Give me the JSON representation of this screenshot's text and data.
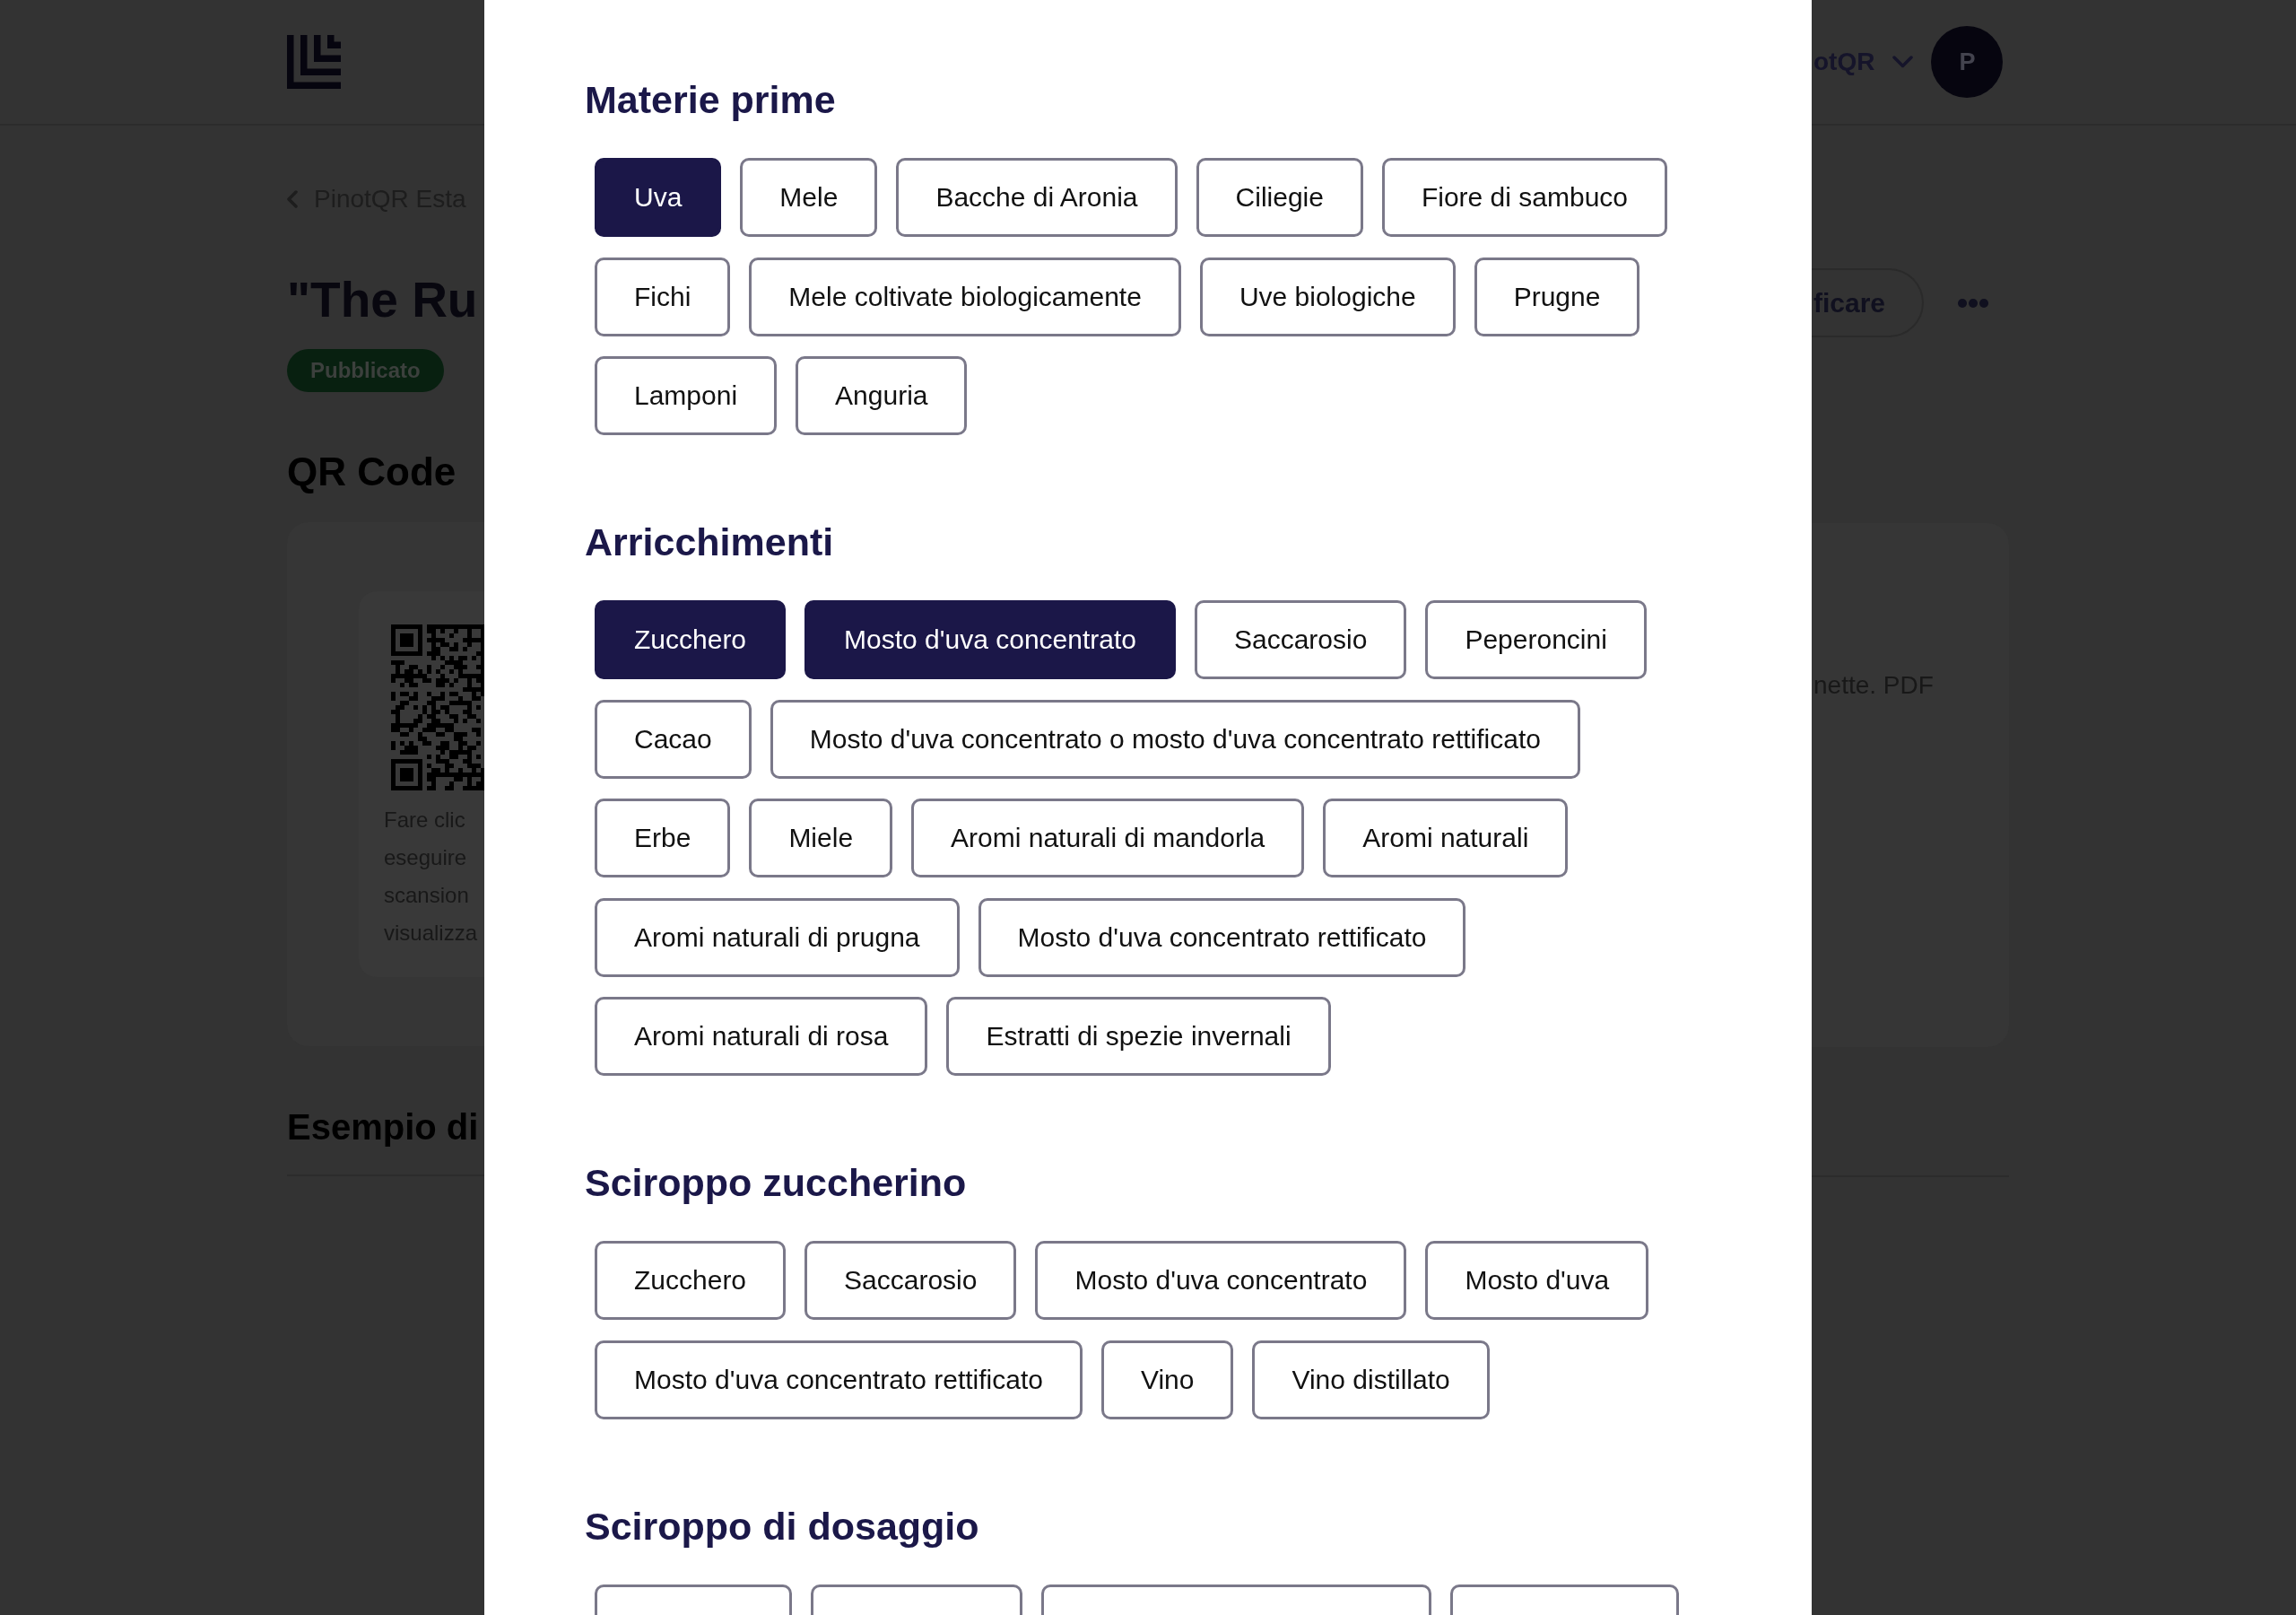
{
  "header": {
    "account_name": "otQR",
    "avatar_initial": "P"
  },
  "page": {
    "breadcrumb": "PinotQR Esta",
    "title": "\"The Ru",
    "status": "Pubblicato",
    "edit_button": "ficare",
    "qr_heading": "QR Code",
    "qr_hint_lines": [
      "Fare clic",
      "eseguire",
      "scansion",
      "visualizza"
    ],
    "side_text": "nette. PDF",
    "example_heading": "Esempio di"
  },
  "modal": {
    "sections": [
      {
        "title": "Materie prime",
        "options": [
          {
            "label": "Uva",
            "selected": true
          },
          {
            "label": "Mele",
            "selected": false
          },
          {
            "label": "Bacche di Aronia",
            "selected": false
          },
          {
            "label": "Ciliegie",
            "selected": false
          },
          {
            "label": "Fiore di sambuco",
            "selected": false
          },
          {
            "label": "Fichi",
            "selected": false
          },
          {
            "label": "Mele coltivate biologicamente",
            "selected": false
          },
          {
            "label": "Uve biologiche",
            "selected": false
          },
          {
            "label": "Prugne",
            "selected": false
          },
          {
            "label": "Lamponi",
            "selected": false
          },
          {
            "label": "Anguria",
            "selected": false
          }
        ]
      },
      {
        "title": "Arricchimenti",
        "options": [
          {
            "label": "Zucchero",
            "selected": true
          },
          {
            "label": "Mosto d'uva concentrato",
            "selected": true
          },
          {
            "label": "Saccarosio",
            "selected": false
          },
          {
            "label": "Peperoncini",
            "selected": false
          },
          {
            "label": "Cacao",
            "selected": false
          },
          {
            "label": "Mosto d'uva concentrato o mosto d'uva concentrato rettificato",
            "selected": false
          },
          {
            "label": "Erbe",
            "selected": false
          },
          {
            "label": "Miele",
            "selected": false
          },
          {
            "label": "Aromi naturali di mandorla",
            "selected": false
          },
          {
            "label": "Aromi naturali",
            "selected": false
          },
          {
            "label": "Aromi naturali di prugna",
            "selected": false
          },
          {
            "label": "Mosto d'uva concentrato rettificato",
            "selected": false
          },
          {
            "label": "Aromi naturali di rosa",
            "selected": false
          },
          {
            "label": "Estratti di spezie invernali",
            "selected": false
          }
        ]
      },
      {
        "title": "Sciroppo zuccherino",
        "options": [
          {
            "label": "Zucchero",
            "selected": false
          },
          {
            "label": "Saccarosio",
            "selected": false
          },
          {
            "label": "Mosto d'uva concentrato",
            "selected": false
          },
          {
            "label": "Mosto d'uva",
            "selected": false
          },
          {
            "label": "Mosto d'uva concentrato rettificato",
            "selected": false
          },
          {
            "label": "Vino",
            "selected": false
          },
          {
            "label": "Vino distillato",
            "selected": false
          }
        ]
      },
      {
        "title": "Sciroppo di dosaggio",
        "options": [
          {
            "selected": false
          },
          {
            "selected": false
          },
          {
            "selected": false
          },
          {
            "selected": false
          }
        ]
      }
    ]
  }
}
